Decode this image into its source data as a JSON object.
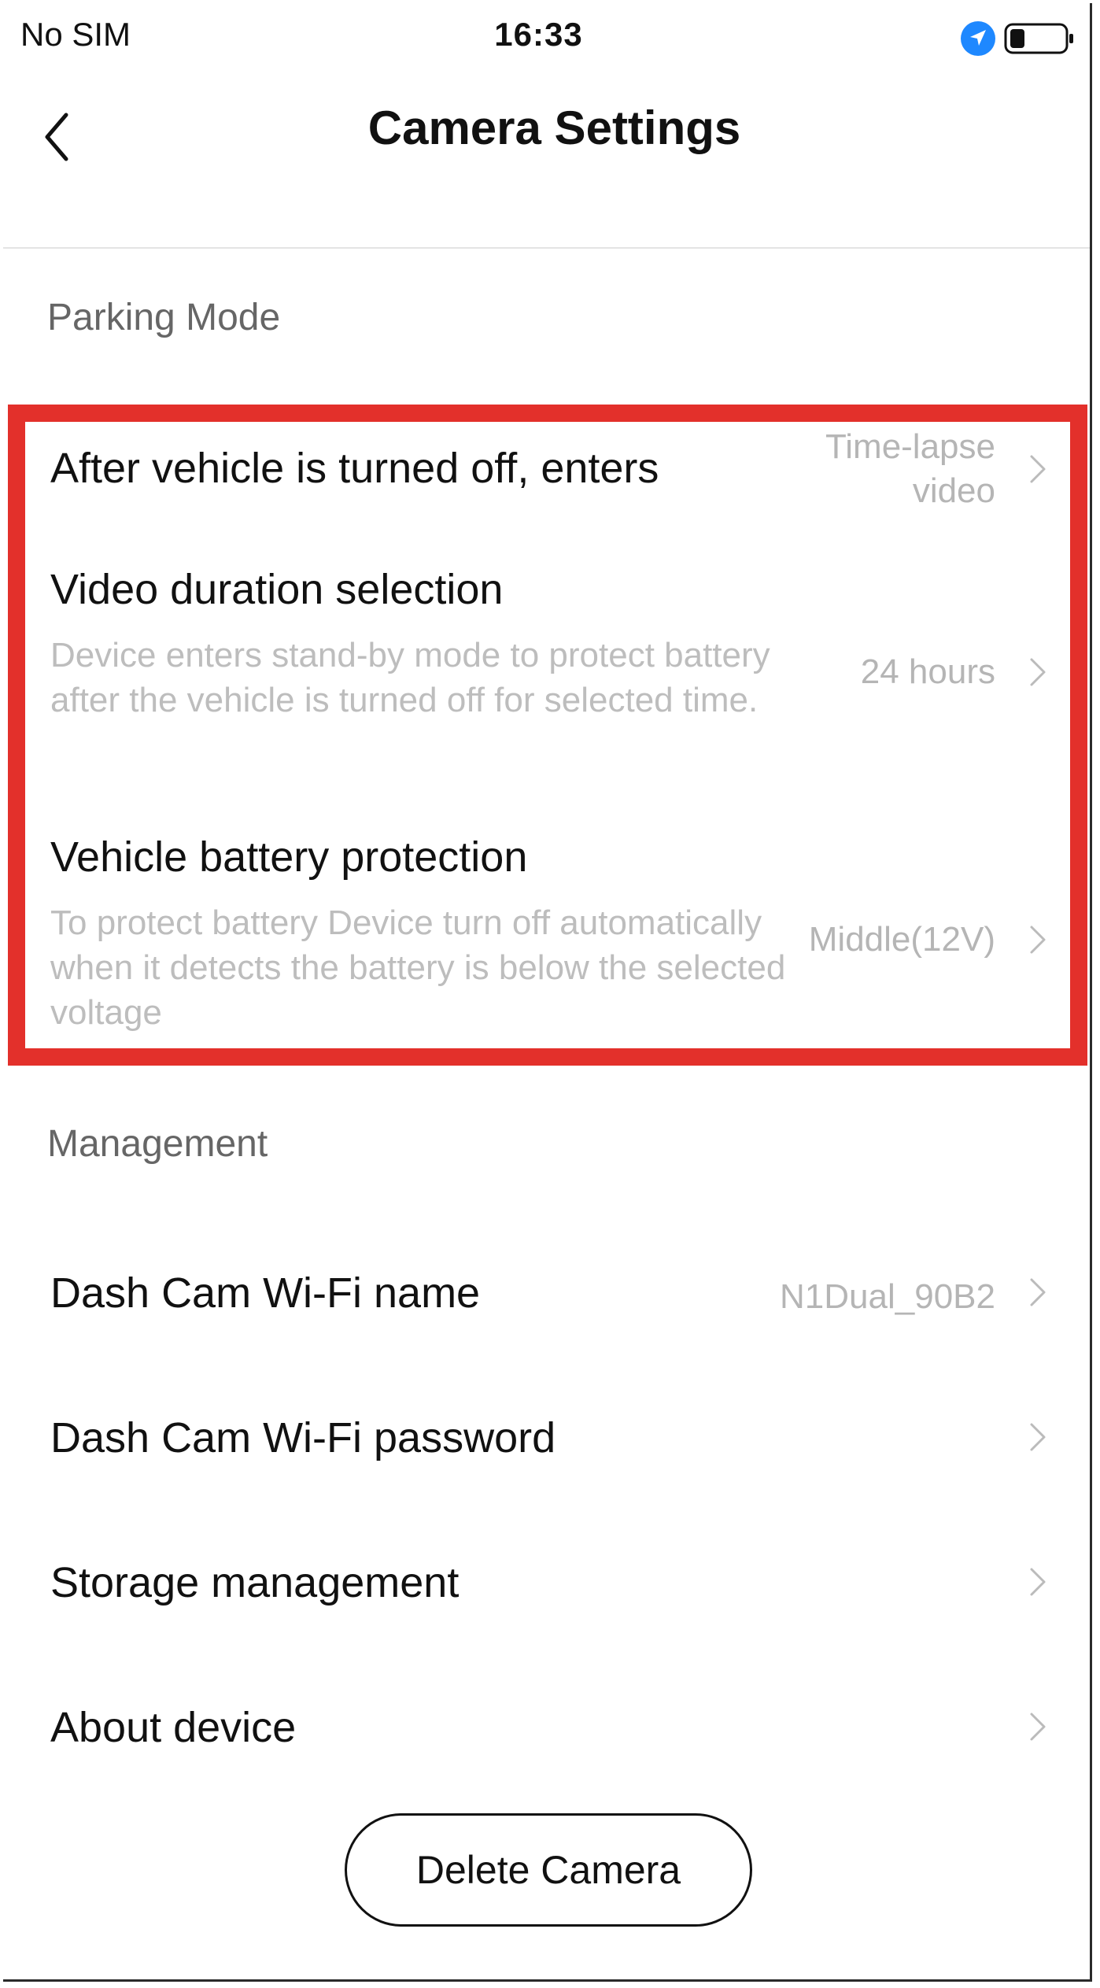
{
  "status_bar": {
    "carrier": "No SIM",
    "time": "16:33",
    "location_icon": "location-arrow-icon",
    "battery_icon": "battery-low-icon",
    "accent_color": "#1e88ff"
  },
  "nav": {
    "back_icon": "chevron-left-icon",
    "title": "Camera Settings"
  },
  "parking_mode": {
    "section_title": "Parking Mode",
    "items": [
      {
        "title": "After vehicle is turned off, enters",
        "value_line1": "Time-lapse",
        "value_line2": "video"
      },
      {
        "title": "Video duration selection",
        "description": "Device enters stand-by mode to protect battery after the vehicle is turned off for selected time.",
        "value": "24 hours"
      },
      {
        "title": "Vehicle battery protection",
        "description": "To protect battery Device turn off automatically when it detects the battery is below the selected voltage",
        "value": "Middle(12V)"
      }
    ],
    "highlight_color": "#e3302b"
  },
  "management": {
    "section_title": "Management",
    "items": [
      {
        "title": "Dash Cam Wi-Fi name",
        "value": "N1Dual_90B2"
      },
      {
        "title": "Dash Cam Wi-Fi password",
        "value": ""
      },
      {
        "title": "Storage management",
        "value": ""
      },
      {
        "title": "About device",
        "value": ""
      }
    ]
  },
  "delete_button": {
    "label": "Delete Camera"
  }
}
